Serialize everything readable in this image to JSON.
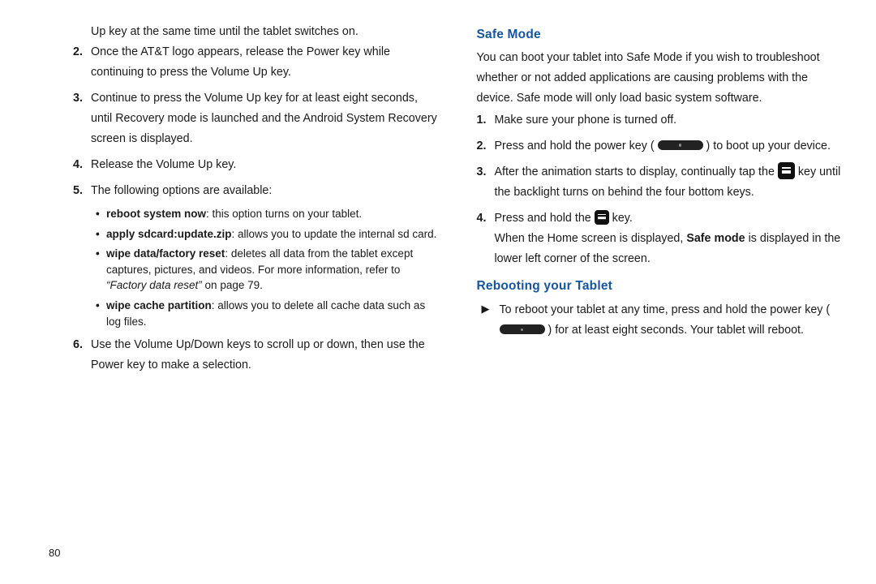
{
  "page_number": "80",
  "left": {
    "intro_line": "Up key at the same time until the tablet switches on.",
    "step2": "Once the AT&T logo appears, release the Power key while continuing to press the Volume Up key.",
    "step3": "Continue to press the Volume Up key for at least eight seconds, until Recovery mode is launched and the Android System Recovery screen is displayed.",
    "step4": "Release the Volume Up key.",
    "step5": "The following options are available:",
    "opt1_b": "reboot system now",
    "opt1_r": ": this option turns on your tablet.",
    "opt2_b": "apply sdcard:update.zip",
    "opt2_r": ": allows you to update the internal sd card.",
    "opt3_b": "wipe data/factory reset",
    "opt3_r": ": deletes all data from the tablet except captures, pictures, and videos. For more information, refer to ",
    "opt3_i": "“Factory data reset” ",
    "opt3_after": " on page 79.",
    "opt4_b": "wipe cache partition",
    "opt4_r": ": allows you to delete all cache data such as log files.",
    "step6": "Use the Volume Up/Down keys to scroll up or down, then use the Power key to make a selection."
  },
  "right": {
    "safe_mode_heading": "Safe Mode",
    "safe_mode_intro": "You can boot your tablet into Safe Mode if you wish to troubleshoot whether or not added applications are causing problems with the device. Safe mode will only load basic system software.",
    "sm_step1": "Make sure your phone is turned off.",
    "sm_step2_a": "Press and hold the power key ( ",
    "sm_step2_b": " ) to boot up your device.",
    "sm_step3_a": "After the animation starts to display, continually tap the ",
    "sm_step3_b": " key until the backlight turns on behind the four bottom keys.",
    "sm_step4_a": "Press and hold the ",
    "sm_step4_b": " key.",
    "sm_step4_line2a": "When the Home screen is displayed, ",
    "sm_step4_line2b": "Safe mode",
    "sm_step4_line2c": " is displayed in the lower left corner of the screen.",
    "reboot_heading": "Rebooting your Tablet",
    "reboot_a": "To reboot your tablet at any time, press and hold the power key ( ",
    "reboot_b": " ) for at least eight seconds. Your tablet will reboot."
  },
  "numbers": {
    "n2": "2.",
    "n3": "3.",
    "n4": "4.",
    "n5": "5.",
    "n6": "6.",
    "r1": "1.",
    "r2": "2.",
    "r3": "3.",
    "r4": "4."
  }
}
